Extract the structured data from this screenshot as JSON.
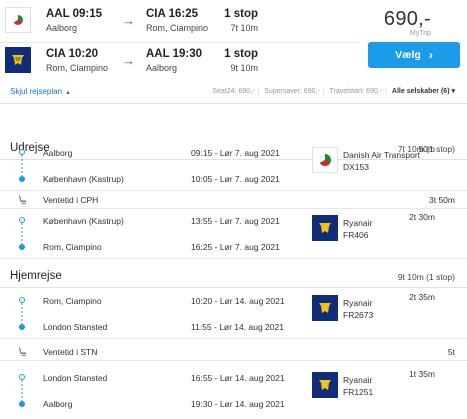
{
  "summary": {
    "outbound": {
      "from_code_time": "AAL  09:15",
      "from_city": "Aalborg",
      "to_code_time": "CIA  16:25",
      "to_city": "Rom, Ciampino",
      "stops": "1 stop",
      "duration": "7t 10m",
      "logo": "dat-logo-icon"
    },
    "return": {
      "from_code_time": "CIA  10:20",
      "from_city": "Rom, Ciampino",
      "to_code_time": "AAL  19:30",
      "to_city": "Aalborg",
      "stops": "1 stop",
      "duration": "9t 10m",
      "logo": "ryanair-logo-icon"
    },
    "arrow": "→",
    "price": "690,-",
    "provider": "MyTrip",
    "select_label": "Vælg",
    "select_arrow": "›",
    "toggle_plan": "Skjul rejseplan",
    "providers": [
      "Seat24: 690,-",
      "Supersaver: 690,-",
      "Travelstart: 690,-"
    ],
    "all_companies": "Alle selskaber",
    "all_count": "(6)",
    "all_chevron": "▾"
  },
  "itinerary": {
    "outbound_title": "Udrejse",
    "outbound_summary": "7t 10m (1 stop)",
    "return_title": "Hjemrejse",
    "return_summary": "9t 10m (1 stop)",
    "segments": [
      {
        "from": "Aalborg",
        "to": "København (Kastrup)",
        "dep": "09:15 - Lør 7. aug 2021",
        "arr": "10:05 - Lør 7. aug 2021",
        "airline": "Danish Air Transport",
        "flight": "DX153",
        "duration": "50m"
      },
      {
        "from": "København (Kastrup)",
        "to": "Rom, Ciampino",
        "dep": "13:55 - Lør 7. aug 2021",
        "arr": "16:25 - Lør 7. aug 2021",
        "airline": "Ryanair",
        "flight": "FR406",
        "duration": "2t 30m"
      },
      {
        "from": "Rom, Ciampino",
        "to": "London Stansted",
        "dep": "10:20 - Lør 14. aug 2021",
        "arr": "11:55 - Lør 14. aug 2021",
        "airline": "Ryanair",
        "flight": "FR2673",
        "duration": "2t 35m"
      },
      {
        "from": "London Stansted",
        "to": "Aalborg",
        "dep": "16:55 - Lør 14. aug 2021",
        "arr": "19:30 - Lør 14. aug 2021",
        "airline": "Ryanair",
        "flight": "FR1251",
        "duration": "1t 35m"
      }
    ],
    "waits": [
      {
        "label": "Ventetid i CPH",
        "duration": "3t 50m"
      },
      {
        "label": "Ventetid i STN",
        "duration": "5t"
      }
    ]
  },
  "colors": {
    "accent": "#1c9be8",
    "link": "#1b73c6",
    "ryanair": "#0f2d7a"
  }
}
